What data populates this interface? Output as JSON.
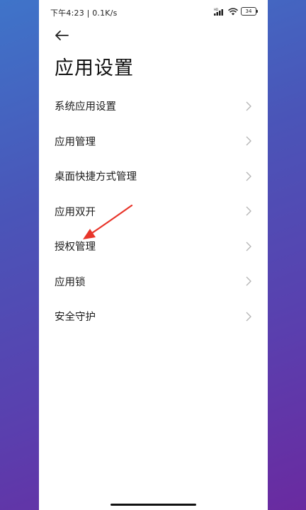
{
  "status_bar": {
    "time_speed": "下午4:23 | 0.1K/s",
    "battery_level": "34"
  },
  "header": {
    "back_icon": "arrow-left-icon",
    "title": "应用设置"
  },
  "menu": {
    "items": [
      {
        "label": "系统应用设置"
      },
      {
        "label": "应用管理"
      },
      {
        "label": "桌面快捷方式管理"
      },
      {
        "label": "应用双开"
      },
      {
        "label": "授权管理"
      },
      {
        "label": "应用锁"
      },
      {
        "label": "安全守护"
      }
    ]
  },
  "annotation": {
    "arrow_color": "#e8352a"
  }
}
